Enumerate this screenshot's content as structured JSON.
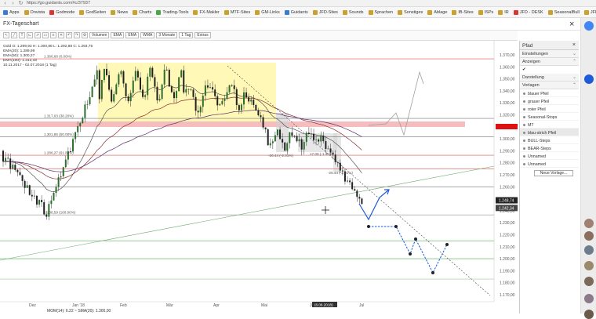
{
  "browser": {
    "url": "https://go.guidants.com/#c/37937",
    "bookmarks": [
      "Apps",
      "Onvista",
      "Godmode",
      "GodSeiten",
      "News",
      "Charts",
      "Trading-Tools",
      "FX-Makler",
      "MTF-Sites",
      "GM-Links",
      "Guidants",
      "JFD-Sites",
      "Sounds",
      "Sprachen",
      "Sonstiges",
      "Ablage",
      "IB-Sites",
      "ISPs",
      "IR",
      "JFD - DESK",
      "SeasonalBull",
      "JFD - YouTube"
    ]
  },
  "app": {
    "title": "FX-Tageschart"
  },
  "toolbar": {
    "buttons": [
      "Volumen",
      "EMA",
      "EMA",
      "WMA",
      "3 Monate",
      "1 Tag",
      "Extras"
    ]
  },
  "chart": {
    "legend": [
      "Gold  O: 1.299,93  H: 1.300,88  L: 1.292,88  C: 1.293,75",
      "EMA(20): 1.289,99",
      "EMA(50): 1.300,27",
      "EMA(100): 1.312,19",
      "10.11.2017 - 02.07.2018 (1 Tag)"
    ],
    "fib_labels": [
      "1.366,68 (0.00%)",
      "1.317,03 (38.20%)",
      "1.301,65 (50.00%)",
      "1.286,27 (61.80%)",
      "1.236,59 (100.00%)"
    ],
    "measure_labels": [
      "-26.44 (-2.01%)",
      "17.00 (-1.30%)",
      "-26.44 (-2.01%)"
    ],
    "y_labels": [
      "1.370,00",
      "1.360,00",
      "1.350,00",
      "1.340,00",
      "1.330,00",
      "1.320,00",
      "1.310,00",
      "1.300,00",
      "1.290,00",
      "1.280,00",
      "1.270,00",
      "1.260,00",
      "1.250,00",
      "1.240,00",
      "1.230,00",
      "1.220,00",
      "1.210,00",
      "1.200,00",
      "1.190,00",
      "1.180,00",
      "1.170,00"
    ],
    "price_tag_1": "1.248,74",
    "price_tag_2": "1.242,34",
    "x_labels": [
      "Dez",
      "Jan '18",
      "Feb",
      "Mär",
      "Apr",
      "Mai",
      "Jun",
      "Jul"
    ],
    "date_tag": "(6.06.2018)",
    "bottom_indicator": "MOM(14): 6.22    ~  SMA(20): 1.300,00"
  },
  "panel": {
    "title": "Pfad",
    "sections": [
      "Einstellungen",
      "Anzeigen",
      "Darstellung",
      "Vorlagen"
    ],
    "checkbox_label": "✔",
    "templates": [
      "blauer Pfeil",
      "grauer Pfeil",
      "roter Pfeil",
      "Seasonal-Stops",
      "MT",
      "blau-strich Pfeil",
      "BULL-Steps",
      "BEAR-Steps",
      "Unnamed",
      "Unnamed"
    ],
    "selected_index": 5,
    "new_button": "Neue Vorlage..."
  },
  "colors": {
    "zone_yellow": "#fff59d",
    "zone_red": "#f4b6b6",
    "candle_up": "#2c6f2c",
    "candle_down": "#222222",
    "path_blue": "#1e5bd8",
    "path_gray": "#9e9e9e"
  }
}
